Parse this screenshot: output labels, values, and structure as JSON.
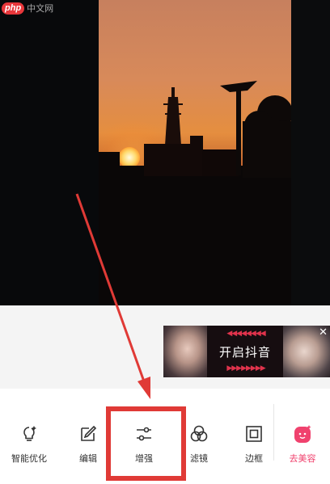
{
  "watermark": {
    "logo": "php",
    "text": "中文网"
  },
  "ad": {
    "text": "开启抖音",
    "close": "✕",
    "arrows_top": "◀◀◀◀◀◀◀◀",
    "arrows_bottom": "▶▶▶▶▶▶▶▶"
  },
  "toolbar": {
    "items": [
      {
        "label": "智能优化",
        "icon": "bulb-sparkle-icon"
      },
      {
        "label": "编辑",
        "icon": "edit-icon"
      },
      {
        "label": "增强",
        "icon": "sliders-icon"
      },
      {
        "label": "滤镜",
        "icon": "filter-circles-icon"
      },
      {
        "label": "边框",
        "icon": "frame-icon"
      },
      {
        "label": "去美容",
        "icon": "meirong-face-icon"
      }
    ]
  },
  "colors": {
    "annotation_red": "#e03a36",
    "brand_pink": "#f0426e"
  }
}
